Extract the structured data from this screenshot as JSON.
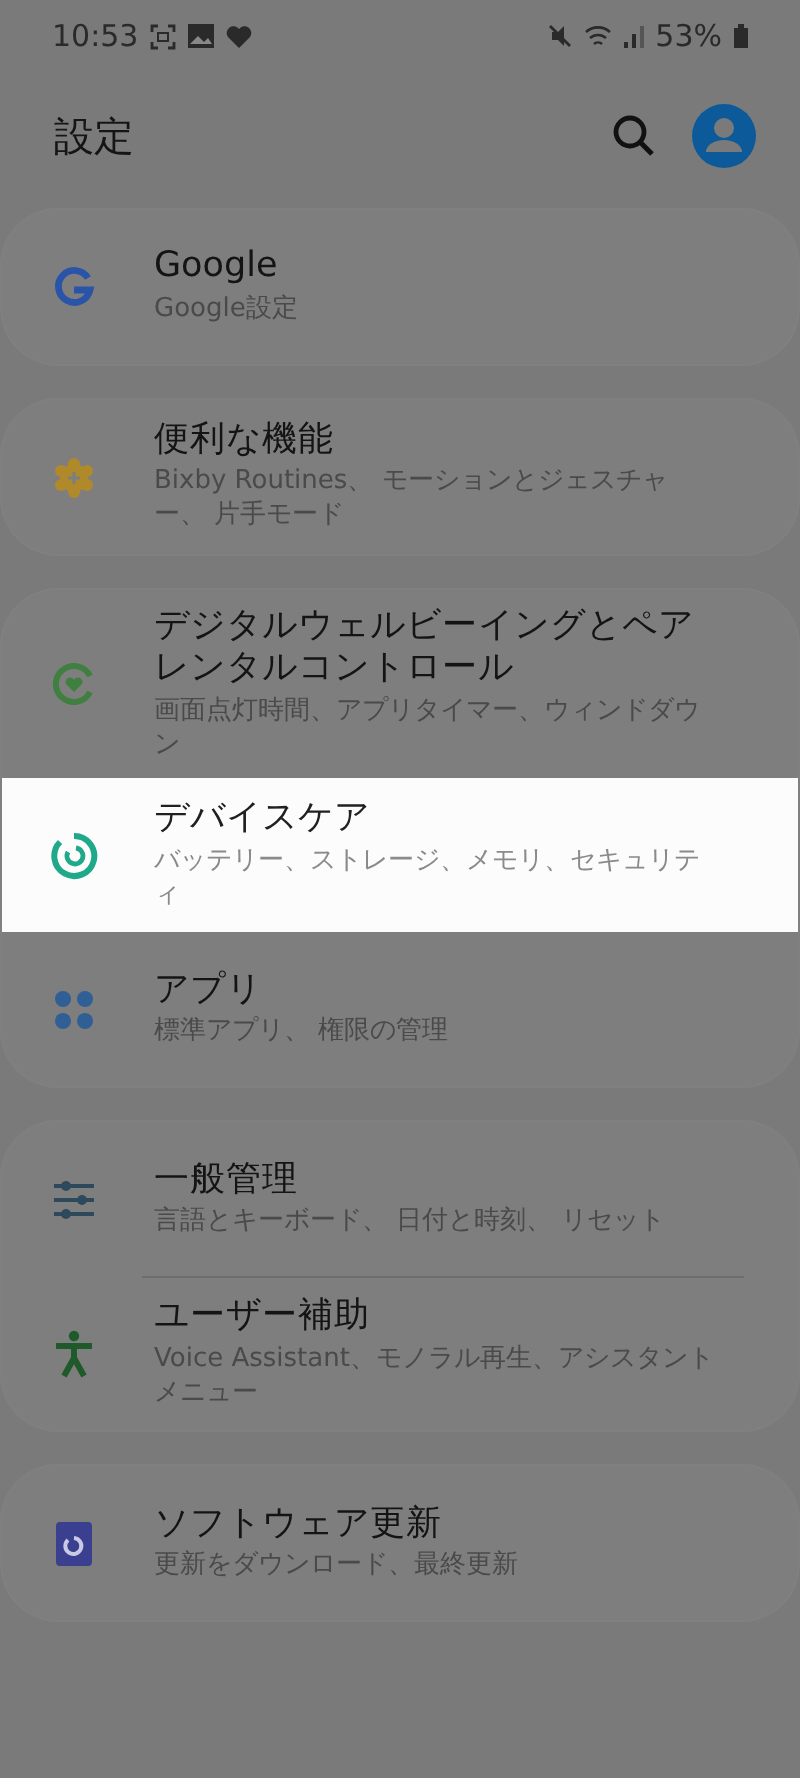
{
  "status_bar": {
    "time": "10:53",
    "battery": "53%"
  },
  "header": {
    "title": "設定"
  },
  "groups": [
    {
      "items": [
        {
          "kind": "google",
          "title": "Google",
          "subtitle": "Google設定",
          "highlighted": false
        }
      ]
    },
    {
      "items": [
        {
          "kind": "features",
          "title": "便利な機能",
          "subtitle": "Bixby Routines、 モーションとジェスチャー、 片手モード",
          "highlighted": false
        }
      ]
    },
    {
      "items": [
        {
          "kind": "wellbeing",
          "title": "デジタルウェルビーイングとペアレンタルコントロール",
          "subtitle": "画面点灯時間、アプリタイマー、ウィンドダウン",
          "highlighted": false
        },
        {
          "kind": "devicecare",
          "title": "デバイスケア",
          "subtitle": "バッテリー、ストレージ、メモリ、セキュリティ",
          "highlighted": true
        },
        {
          "kind": "apps",
          "title": "アプリ",
          "subtitle": "標準アプリ、 権限の管理",
          "highlighted": false
        }
      ]
    },
    {
      "items": [
        {
          "kind": "general",
          "title": "一般管理",
          "subtitle": "言語とキーボード、 日付と時刻、 リセット",
          "highlighted": false
        },
        {
          "kind": "accessibility",
          "title": "ユーザー補助",
          "subtitle": "Voice Assistant、モノラル再生、アシスタントメニュー",
          "highlighted": false
        }
      ]
    },
    {
      "items": [
        {
          "kind": "update",
          "title": "ソフトウェア更新",
          "subtitle": "更新をダウンロード、最終更新",
          "highlighted": false
        }
      ]
    }
  ]
}
